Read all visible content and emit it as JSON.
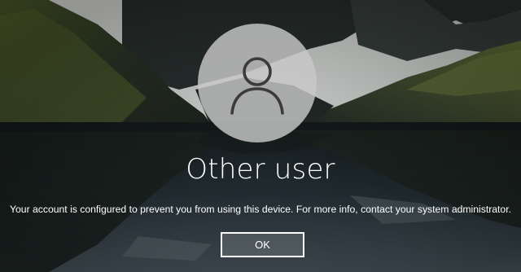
{
  "user": {
    "name": "Other user",
    "avatar_icon": "person-icon"
  },
  "message": "Your account is configured to prevent you from using this device. For more info, contact your system administrator.",
  "ok_button": {
    "label": "OK"
  },
  "colors": {
    "sky": "#d9dcd6",
    "mountain_dark": "#1c2521",
    "mountain_green": "#5c6a34",
    "water": "#3e4a52",
    "text": "#ffffff"
  }
}
